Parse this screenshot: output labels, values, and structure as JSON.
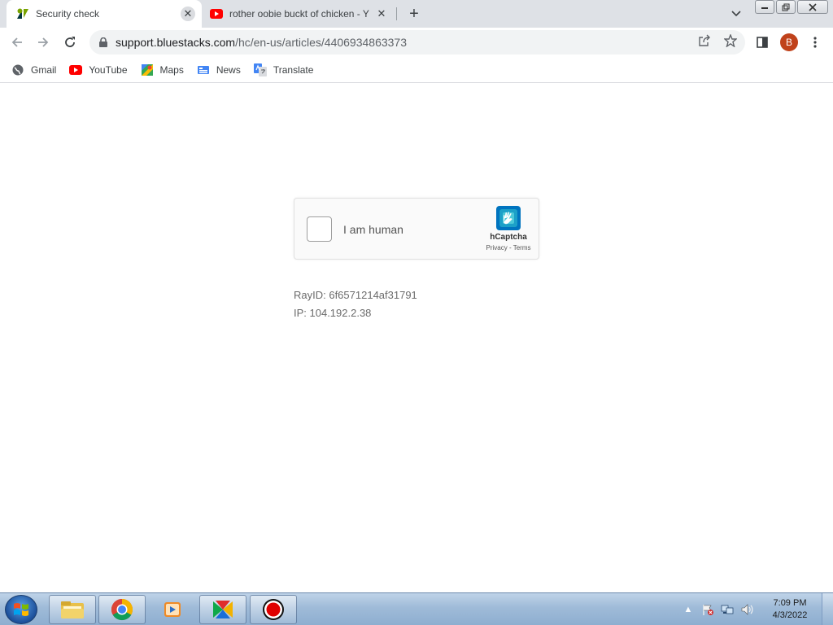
{
  "tabs": [
    {
      "title": "Security check",
      "icon": "zendesk-icon",
      "close": "✕"
    },
    {
      "title": "rother oobie buckt of chicken - Y",
      "icon": "youtube-icon",
      "close": "✕"
    }
  ],
  "new_tab_glyph": "+",
  "toolbar": {
    "url_host": "support.bluestacks.com",
    "url_path": "/hc/en-us/articles/4406934863373",
    "profile_initial": "B"
  },
  "bookmarks": [
    {
      "label": "Gmail",
      "icon": "globe-icon"
    },
    {
      "label": "YouTube",
      "icon": "youtube-icon"
    },
    {
      "label": "Maps",
      "icon": "maps-icon"
    },
    {
      "label": "News",
      "icon": "news-icon"
    },
    {
      "label": "Translate",
      "icon": "translate-icon"
    }
  ],
  "captcha": {
    "label": "I am human",
    "brand": "hCaptcha",
    "privacy": "Privacy",
    "separator": " - ",
    "terms": "Terms"
  },
  "info": {
    "ray": "RayID: 6f6571214af31791",
    "ip": "IP: 104.192.2.38"
  },
  "taskbar": {
    "time": "7:09 PM",
    "date": "4/3/2022",
    "tray_arrow": "▲"
  },
  "colors": {
    "tabstrip_bg": "#dee1e6",
    "omnibox_bg": "#f1f3f4",
    "avatar": "#c0421b",
    "hcaptcha_teal": "#0074bf"
  }
}
